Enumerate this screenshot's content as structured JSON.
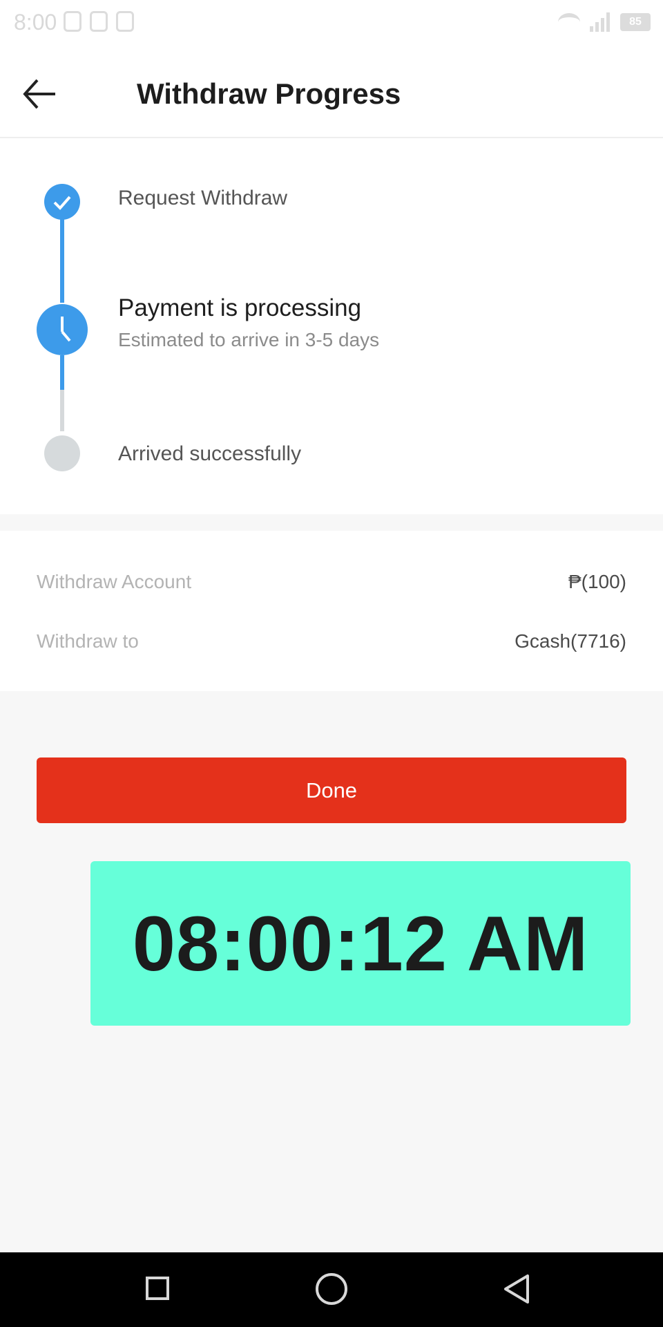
{
  "status_bar": {
    "time": "8:00",
    "battery": "85"
  },
  "header": {
    "title": "Withdraw Progress",
    "back_icon": "arrow-left-icon"
  },
  "progress": {
    "steps": [
      {
        "label": "Request Withdraw",
        "state": "completed",
        "icon": "check-icon"
      },
      {
        "label": "Payment is processing",
        "subtitle": "Estimated to arrive in 3-5 days",
        "state": "current",
        "icon": "clock-icon"
      },
      {
        "label": "Arrived successfully",
        "state": "pending",
        "icon": "dot-icon"
      }
    ]
  },
  "details": {
    "rows": [
      {
        "key": "Withdraw Account",
        "value": "₱(100)"
      },
      {
        "key": "Withdraw to",
        "value": "Gcash(7716)"
      }
    ]
  },
  "actions": {
    "done_label": "Done"
  },
  "overlay": {
    "clock": "08:00:12 AM"
  },
  "colors": {
    "accent_blue": "#3d9bea",
    "done_red": "#e4311b",
    "clock_bg": "#66ffd9"
  }
}
